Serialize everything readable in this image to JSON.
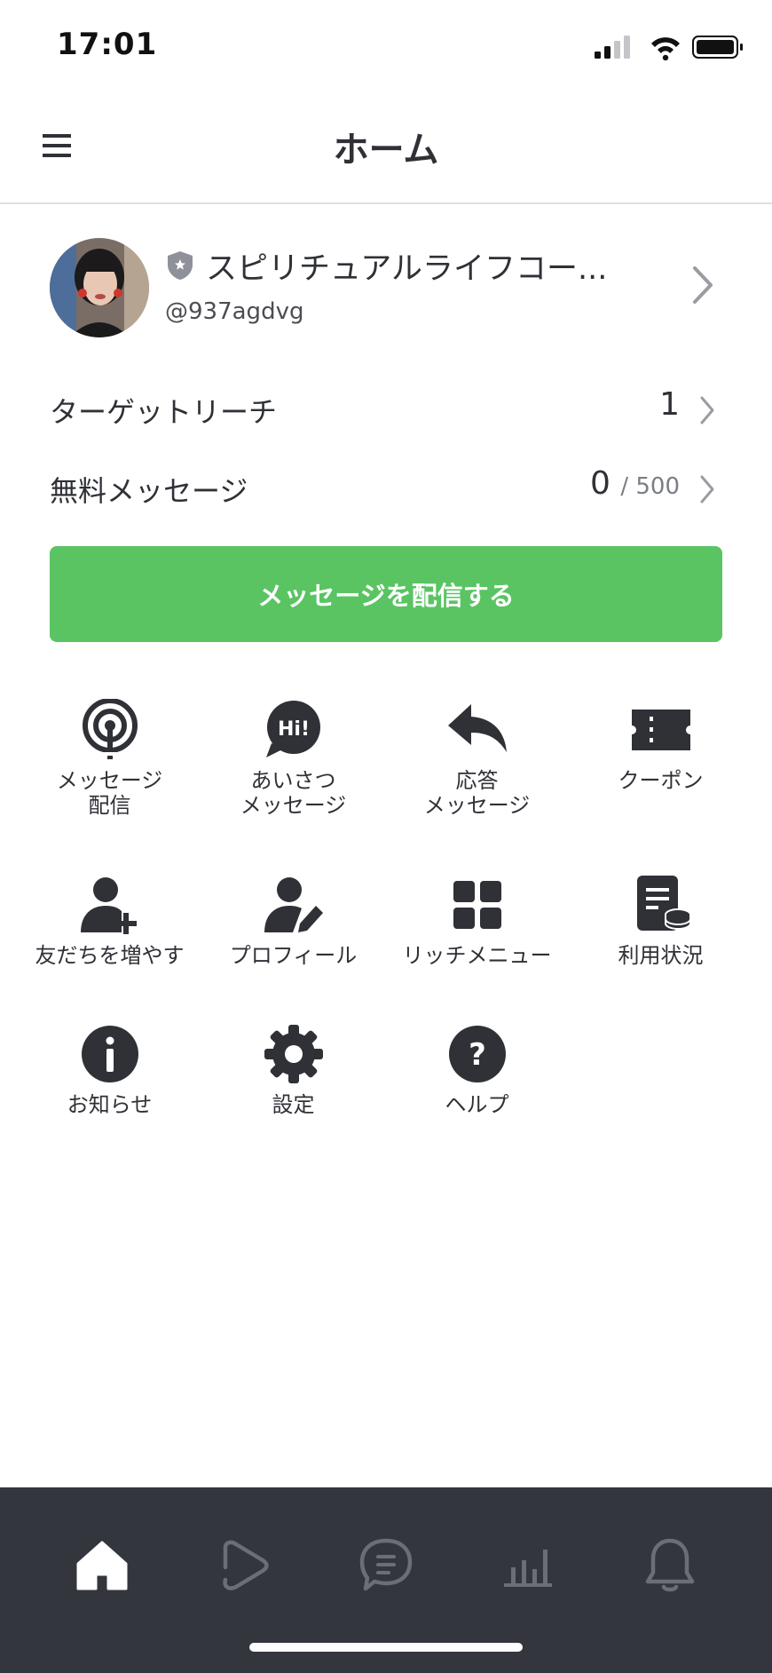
{
  "status_bar": {
    "time": "17:01"
  },
  "header": {
    "title": "ホーム"
  },
  "account": {
    "name": "スピリチュアルライフコー...",
    "id": "@937agdvg"
  },
  "stats": {
    "target_reach_label": "ターゲットリーチ",
    "target_reach_value": "1",
    "free_messages_label": "無料メッセージ",
    "free_messages_used": "0",
    "free_messages_limit": "/ 500"
  },
  "cta": {
    "label": "メッセージを配信する"
  },
  "grid": [
    {
      "icon": "broadcast-icon",
      "label": "メッセージ\n配信"
    },
    {
      "icon": "greeting-hi-icon",
      "label": "あいさつ\nメッセージ"
    },
    {
      "icon": "reply-arrow-icon",
      "label": "応答\nメッセージ"
    },
    {
      "icon": "coupon-ticket-icon",
      "label": "クーポン"
    },
    {
      "icon": "add-friend-icon",
      "label": "友だちを増やす"
    },
    {
      "icon": "edit-profile-icon",
      "label": "プロフィール"
    },
    {
      "icon": "rich-menu-grid-icon",
      "label": "リッチメニュー"
    },
    {
      "icon": "usage-document-icon",
      "label": "利用状況"
    },
    {
      "icon": "info-icon",
      "label": "お知らせ"
    },
    {
      "icon": "gear-icon",
      "label": "設定"
    },
    {
      "icon": "help-question-icon",
      "label": "ヘルプ"
    }
  ],
  "tab_bar": {
    "tabs": [
      "home-icon",
      "timeline-play-icon",
      "chat-icon",
      "analytics-icon",
      "notification-bell-icon"
    ],
    "active": "home-icon"
  },
  "colors": {
    "accent_green": "#5ac463",
    "text_dark": "#2f3137",
    "tab_bar_bg": "#33363d",
    "tab_inactive": "#6b6e75"
  }
}
